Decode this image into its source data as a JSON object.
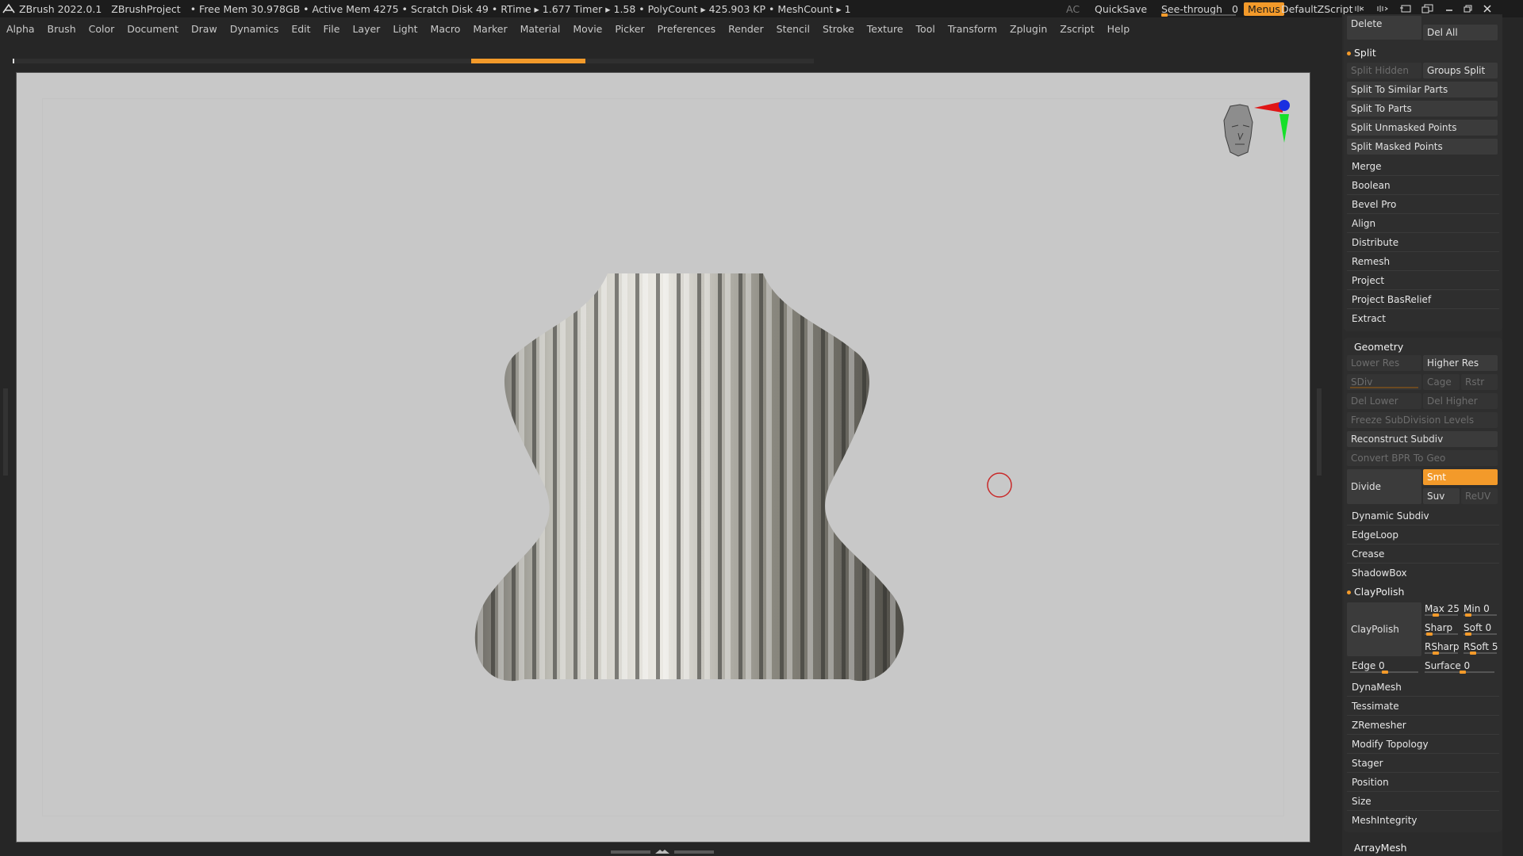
{
  "title_bar": {
    "app": "ZBrush 2022.0.1",
    "project": "ZBrushProject",
    "status": "• Free Mem 30.978GB • Active Mem 4275 • Scratch Disk 49 •  RTime ▸ 1.677 Timer ▸ 1.58 • PolyCount ▸ 425.903 KP  • MeshCount ▸ 1",
    "ac": "AC",
    "quicksave": "QuickSave",
    "see_through_label": "See-through",
    "see_through_value": "0",
    "menus": "Menus",
    "script": "DefaultZScript"
  },
  "menu": [
    "Alpha",
    "Brush",
    "Color",
    "Document",
    "Draw",
    "Dynamics",
    "Edit",
    "File",
    "Layer",
    "Light",
    "Macro",
    "Marker",
    "Material",
    "Movie",
    "Picker",
    "Preferences",
    "Render",
    "Stencil",
    "Stroke",
    "Texture",
    "Tool",
    "Transform",
    "Zplugin",
    "Zscript",
    "Help"
  ],
  "subtool": {
    "delete": "Delete",
    "del_all": "Del All",
    "split_header": "Split",
    "split_hidden": "Split Hidden",
    "groups_split": "Groups Split",
    "split_similar": "Split To Similar Parts",
    "split_parts": "Split To Parts",
    "split_unmasked": "Split Unmasked Points",
    "split_masked": "Split Masked Points",
    "items": [
      "Merge",
      "Boolean",
      "Bevel Pro",
      "Align",
      "Distribute",
      "Remesh",
      "Project",
      "Project BasRelief",
      "Extract"
    ]
  },
  "geometry": {
    "header": "Geometry",
    "lower_res": "Lower Res",
    "higher_res": "Higher Res",
    "sdiv": "SDiv",
    "cage": "Cage",
    "rstr": "Rstr",
    "del_lower": "Del Lower",
    "del_higher": "Del Higher",
    "freeze": "Freeze SubDivision Levels",
    "reconstruct": "Reconstruct Subdiv",
    "convert_bpr": "Convert BPR To Geo",
    "divide": "Divide",
    "smt": "Smt",
    "suv": "Suv",
    "reuv": "ReUV",
    "items1": [
      "Dynamic Subdiv",
      "EdgeLoop",
      "Crease",
      "ShadowBox"
    ],
    "claypolish_header": "ClayPolish",
    "claypolish_btn": "ClayPolish",
    "max": "Max 25",
    "min": "Min 0",
    "sharp": "Sharp",
    "soft": "Soft 0",
    "rsharp": "RSharp",
    "rsoft": "RSoft 5",
    "edge": "Edge 0",
    "surface": "Surface 0",
    "items2": [
      "DynaMesh",
      "Tessimate",
      "ZRemesher",
      "Modify Topology",
      "Stager",
      "Position",
      "Size",
      "MeshIntegrity"
    ],
    "arraymesh": "ArrayMesh"
  },
  "colors": {
    "accent": "#f39a2a",
    "canvas": "#c8c8c8"
  }
}
